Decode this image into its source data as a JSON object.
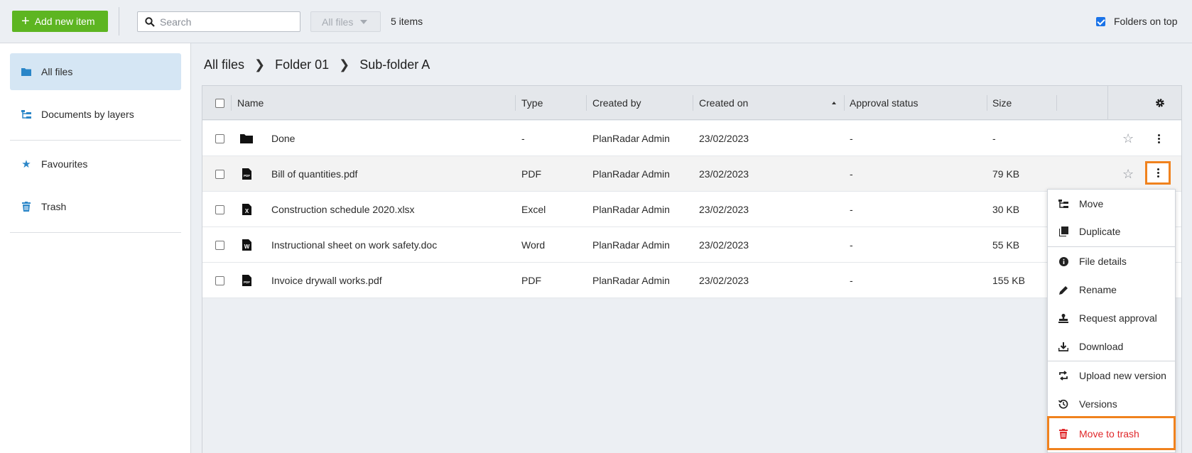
{
  "toolbar": {
    "add_button_label": "Add new item",
    "search_placeholder": "Search",
    "filter_label": "All files",
    "items_count": "5 items",
    "folders_on_top_label": "Folders on top",
    "folders_on_top_checked": true
  },
  "sidebar": {
    "items": [
      {
        "label": "All files",
        "icon": "folder-icon",
        "active": true
      },
      {
        "label": "Documents by layers",
        "icon": "layers-icon",
        "active": false
      },
      {
        "label": "Favourites",
        "icon": "star-icon",
        "active": false
      },
      {
        "label": "Trash",
        "icon": "trash-icon",
        "active": false
      }
    ]
  },
  "breadcrumb": [
    "All files",
    "Folder 01",
    "Sub-folder A"
  ],
  "table": {
    "columns": [
      "Name",
      "Type",
      "Created by",
      "Created on",
      "Approval status",
      "Size"
    ],
    "sorted_column": "Created on",
    "rows": [
      {
        "name": "Done",
        "icon": "folder-icon",
        "type": "-",
        "created_by": "PlanRadar Admin",
        "created_on": "23/02/2023",
        "approval": "-",
        "size": "-"
      },
      {
        "name": "Bill of quantities.pdf",
        "icon": "pdf-file-icon",
        "type": "PDF",
        "created_by": "PlanRadar Admin",
        "created_on": "23/02/2023",
        "approval": "-",
        "size": "79 KB"
      },
      {
        "name": "Construction schedule 2020.xlsx",
        "icon": "excel-file-icon",
        "type": "Excel",
        "created_by": "PlanRadar Admin",
        "created_on": "23/02/2023",
        "approval": "-",
        "size": "30 KB"
      },
      {
        "name": "Instructional sheet on work safety.doc",
        "icon": "word-file-icon",
        "type": "Word",
        "created_by": "PlanRadar Admin",
        "created_on": "23/02/2023",
        "approval": "-",
        "size": "55 KB"
      },
      {
        "name": "Invoice drywall works.pdf",
        "icon": "pdf-file-icon",
        "type": "PDF",
        "created_by": "PlanRadar Admin",
        "created_on": "23/02/2023",
        "approval": "-",
        "size": "155 KB"
      }
    ]
  },
  "context_menu": {
    "items": [
      {
        "label": "Move",
        "icon": "move-icon"
      },
      {
        "label": "Duplicate",
        "icon": "duplicate-icon"
      },
      {
        "label": "File details",
        "icon": "info-icon"
      },
      {
        "label": "Rename",
        "icon": "pencil-icon"
      },
      {
        "label": "Request approval",
        "icon": "stamp-icon"
      },
      {
        "label": "Download",
        "icon": "download-icon"
      },
      {
        "label": "Upload new version",
        "icon": "upload-version-icon"
      },
      {
        "label": "Versions",
        "icon": "history-icon"
      },
      {
        "label": "Move to trash",
        "icon": "trash-icon"
      }
    ]
  },
  "colors": {
    "accent_green": "#5db521",
    "active_blue": "#d5e6f4",
    "highlight_orange": "#f0821e",
    "danger_red": "#e0272a"
  }
}
